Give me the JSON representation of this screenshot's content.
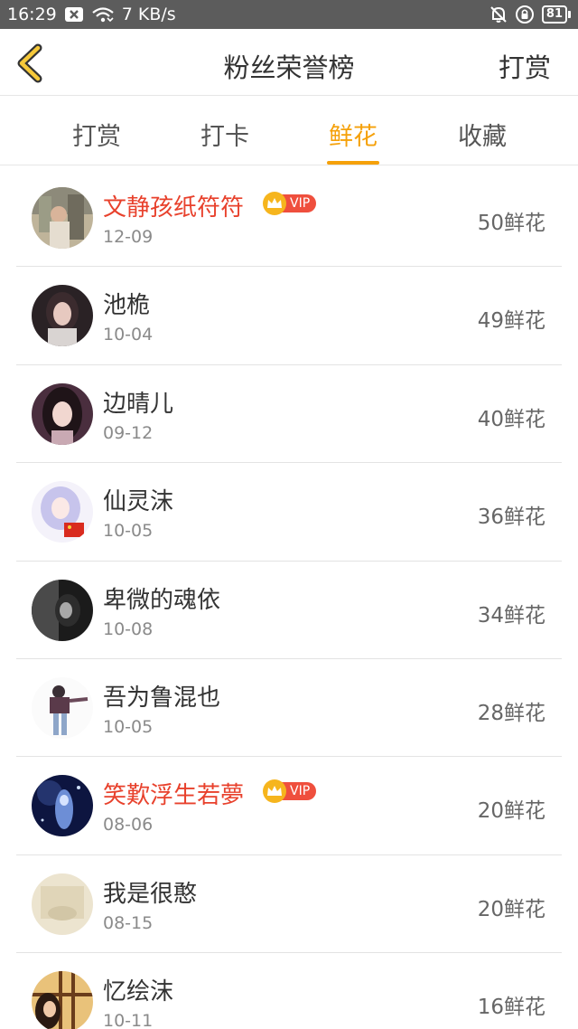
{
  "status": {
    "time": "16:29",
    "speed": "7 KB/s",
    "battery": "81"
  },
  "header": {
    "title": "粉丝荣誉榜",
    "right_action": "打赏"
  },
  "tabs": [
    {
      "label": "打赏"
    },
    {
      "label": "打卡"
    },
    {
      "label": "鲜花"
    },
    {
      "label": "收藏"
    }
  ],
  "vip_label": "VIP",
  "fans": [
    {
      "name": "文静孩纸符符",
      "date": "12-09",
      "count": "50鲜花",
      "vip": true
    },
    {
      "name": "池桅",
      "date": "10-04",
      "count": "49鲜花",
      "vip": false
    },
    {
      "name": "边晴儿",
      "date": "09-12",
      "count": "40鲜花",
      "vip": false
    },
    {
      "name": "仙灵沫",
      "date": "10-05",
      "count": "36鲜花",
      "vip": false
    },
    {
      "name": "卑微的魂依",
      "date": "10-08",
      "count": "34鲜花",
      "vip": false
    },
    {
      "name": "吾为鲁混也",
      "date": "10-05",
      "count": "28鲜花",
      "vip": false
    },
    {
      "name": "笑歎浮生若夢",
      "date": "08-06",
      "count": "20鲜花",
      "vip": true
    },
    {
      "name": "我是很憨",
      "date": "08-15",
      "count": "20鲜花",
      "vip": false
    },
    {
      "name": "忆绘沫",
      "date": "10-11",
      "count": "16鲜花",
      "vip": false
    }
  ],
  "colors": {
    "accent": "#f5a10a",
    "vip_name": "#e8412c",
    "vip_badge": "#ef4f3d",
    "crown": "#f6b51d"
  }
}
